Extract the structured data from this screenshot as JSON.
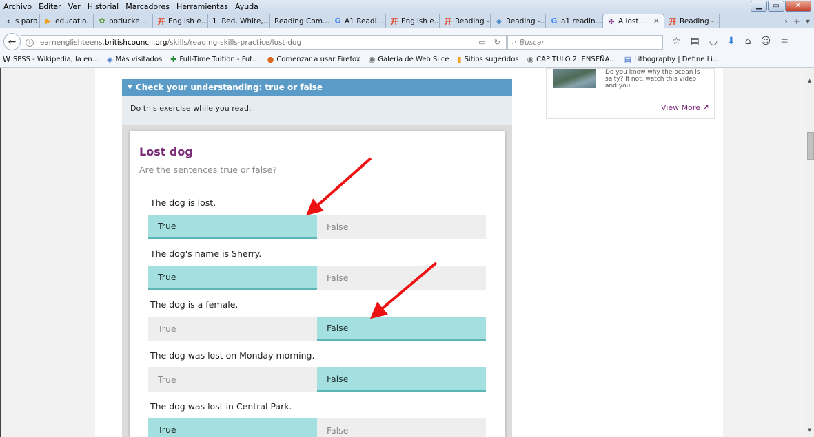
{
  "menubar": {
    "items": [
      "Archivo",
      "Editar",
      "Ver",
      "Historial",
      "Marcadores",
      "Herramientas",
      "Ayuda"
    ]
  },
  "tabs": [
    {
      "label": "s para...",
      "icon": "chevron-left-icon"
    },
    {
      "label": "educatio...",
      "icon": "play-icon"
    },
    {
      "label": "potlucke...",
      "icon": "plant-icon"
    },
    {
      "label": "English e...",
      "icon": "hanzi-icon"
    },
    {
      "label": "1. Red, White,...",
      "icon": ""
    },
    {
      "label": "Reading Com...",
      "icon": ""
    },
    {
      "label": "A1 Readi...",
      "icon": "google-icon"
    },
    {
      "label": "English e...",
      "icon": "hanzi-icon"
    },
    {
      "label": "Reading -...",
      "icon": "hanzi-icon"
    },
    {
      "label": "Reading -...",
      "icon": "image-icon"
    },
    {
      "label": "a1 readin...",
      "icon": "google-icon"
    },
    {
      "label": "A lost ...",
      "icon": "british-council-icon",
      "active": true
    },
    {
      "label": "Reading -...",
      "icon": "hanzi-icon"
    }
  ],
  "navbar": {
    "url_prefix": "learnenglishteens.",
    "url_domain": "britishcouncil.org",
    "url_path": "/skills/reading-skills-practice/lost-dog",
    "search_placeholder": "Buscar"
  },
  "bookmarks": [
    {
      "label": "SPSS - Wikipedia, la en...",
      "icon": "W"
    },
    {
      "label": "Más visitados",
      "icon": "◈"
    },
    {
      "label": "Full-Time Tuition - Fut...",
      "icon": "✚"
    },
    {
      "label": "Comenzar a usar Firefox",
      "icon": "●"
    },
    {
      "label": "Galería de Web Slice",
      "icon": "◉"
    },
    {
      "label": "Sitios sugeridos",
      "icon": "▮"
    },
    {
      "label": "CAPITULO 2: ENSEÑA...",
      "icon": "◉"
    },
    {
      "label": "Lithography | Define Li...",
      "icon": "▤"
    }
  ],
  "page": {
    "banner": "Check your understanding: true or false",
    "instruction": "Do this exercise while you read.",
    "exercise_title": "Lost dog",
    "exercise_subtitle": "Are the sentences true or false?",
    "true_label": "True",
    "false_label": "False",
    "questions": [
      {
        "text": "The dog is lost.",
        "selected": "true"
      },
      {
        "text": "The dog's name is Sherry.",
        "selected": "true"
      },
      {
        "text": "The dog is a female.",
        "selected": "false"
      },
      {
        "text": "The dog was lost on Monday morning.",
        "selected": "false"
      },
      {
        "text": "The dog was lost in Central Park.",
        "selected": "true"
      }
    ],
    "colors": {
      "selected_option": "#a5e0e0",
      "banner": "#5a9bc7",
      "title": "#7a2a77",
      "annotation_arrow": "#ee1111"
    }
  },
  "sidebar": {
    "teaser": "Do you know why the ocean is salty? If not, watch this video and you'...",
    "view_more": "View More"
  }
}
